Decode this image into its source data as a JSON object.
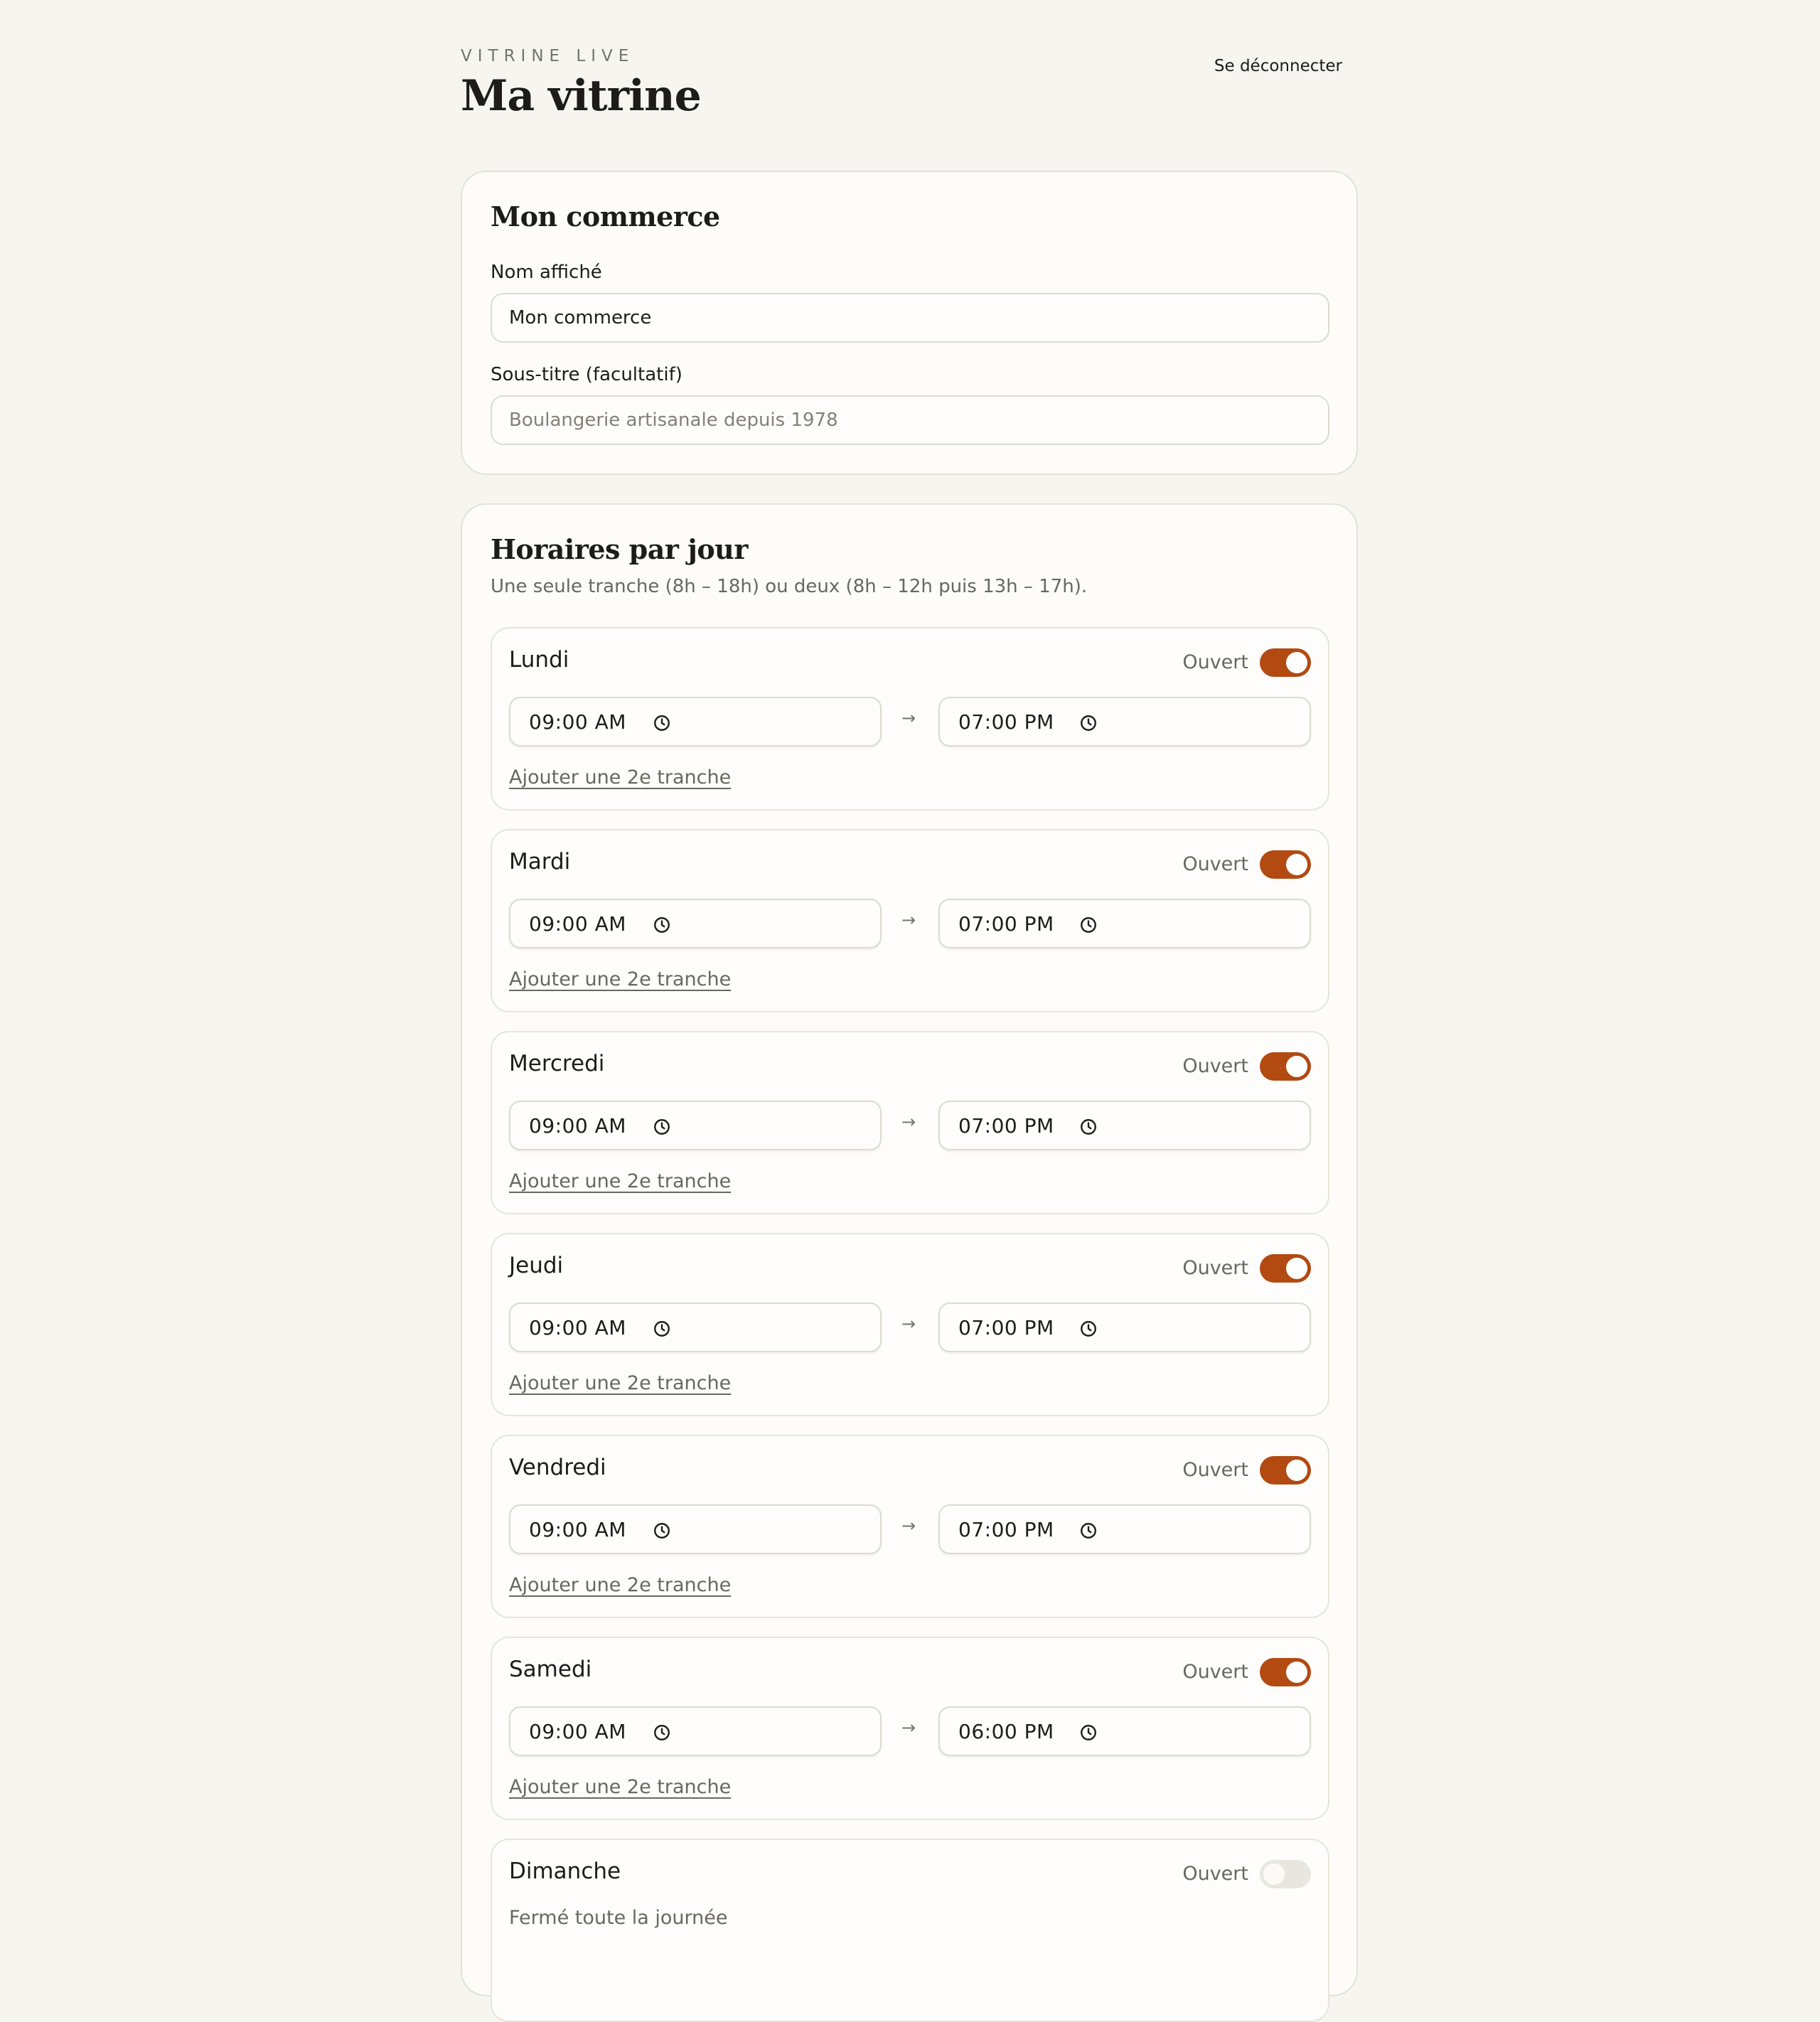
{
  "header": {
    "brand": "VITRINE LIVE",
    "title": "Ma vitrine",
    "logout_label": "Se déconnecter"
  },
  "shop": {
    "title": "Mon commerce",
    "name_label": "Nom affiché",
    "name_value": "Mon commerce",
    "subtitle_label": "Sous-titre (facultatif)",
    "subtitle_placeholder": "Boulangerie artisanale depuis 1978"
  },
  "hours": {
    "title": "Horaires par jour",
    "subtitle": "Une seule tranche (8h – 18h) ou deux (8h – 12h puis 13h – 17h).",
    "open_label": "Ouvert",
    "arrow": "→",
    "add_slot_label": "Ajouter une 2e tranche",
    "closed_text": "Fermé toute la journée",
    "days": [
      {
        "name": "Lundi",
        "open": true,
        "from": "09:00 AM",
        "to": "07:00 PM"
      },
      {
        "name": "Mardi",
        "open": true,
        "from": "09:00 AM",
        "to": "07:00 PM"
      },
      {
        "name": "Mercredi",
        "open": true,
        "from": "09:00 AM",
        "to": "07:00 PM"
      },
      {
        "name": "Jeudi",
        "open": true,
        "from": "09:00 AM",
        "to": "07:00 PM"
      },
      {
        "name": "Vendredi",
        "open": true,
        "from": "09:00 AM",
        "to": "07:00 PM"
      },
      {
        "name": "Samedi",
        "open": true,
        "from": "09:00 AM",
        "to": "06:00 PM"
      },
      {
        "name": "Dimanche",
        "open": false
      }
    ]
  },
  "icons": {
    "time_input": "clock-icon",
    "separator": "arrow-right-icon"
  },
  "colors": {
    "accent": "#b24a12",
    "toggle_off": "#e9e6e0",
    "background": "#f7f5f0",
    "card": "#fdfcf9",
    "text": "#1e1c1a",
    "muted": "#6b665f"
  }
}
